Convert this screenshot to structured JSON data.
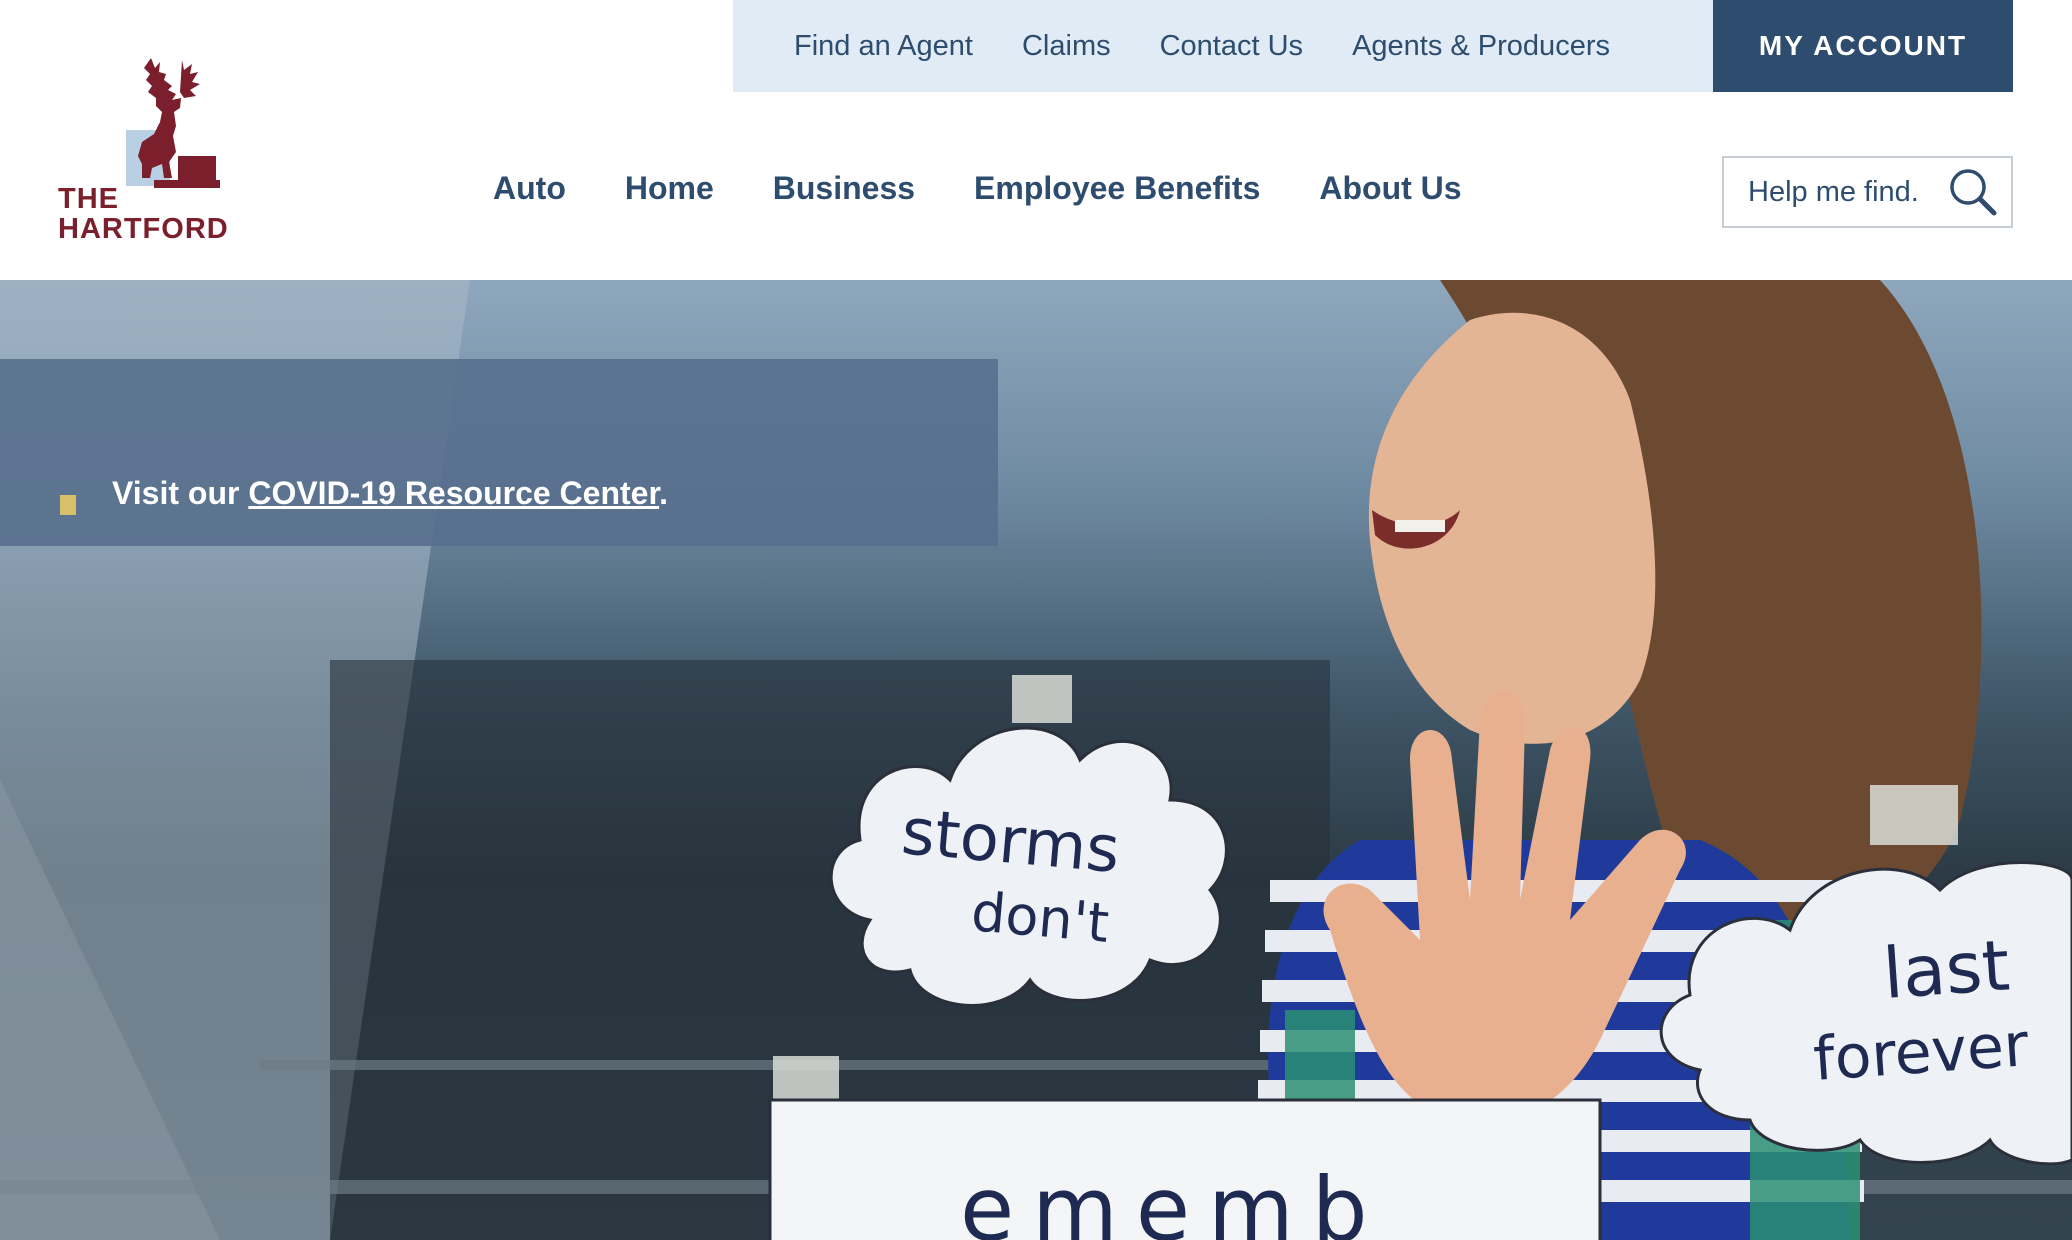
{
  "brand": {
    "logo_line1": "THE",
    "logo_line2": "HARTFORD",
    "logo_icon": "stag-icon",
    "logo_color": "#7a1f2b"
  },
  "utility_nav": {
    "links": [
      "Find an Agent",
      "Claims",
      "Contact Us",
      "Agents & Producers"
    ],
    "account_button": "MY ACCOUNT",
    "background": "#e0ebf5",
    "account_background": "#2e4d6e"
  },
  "main_nav": {
    "items": [
      "Auto",
      "Home",
      "Business",
      "Employee Benefits",
      "About Us"
    ],
    "text_color": "#2e4d6e"
  },
  "search": {
    "placeholder": "Help me find.",
    "icon": "search-icon"
  },
  "hero": {
    "banner": {
      "prefix": "Visit our ",
      "link_text": "COVID-19 Resource Center",
      "suffix": ".",
      "marker_color": "#d8c06a"
    },
    "signs": {
      "cloud_left_line1": "storms",
      "cloud_left_line2": "don't",
      "cloud_right_line1": "last",
      "cloud_right_line2": "forever",
      "bottom_sign_partial": "ememb"
    }
  }
}
